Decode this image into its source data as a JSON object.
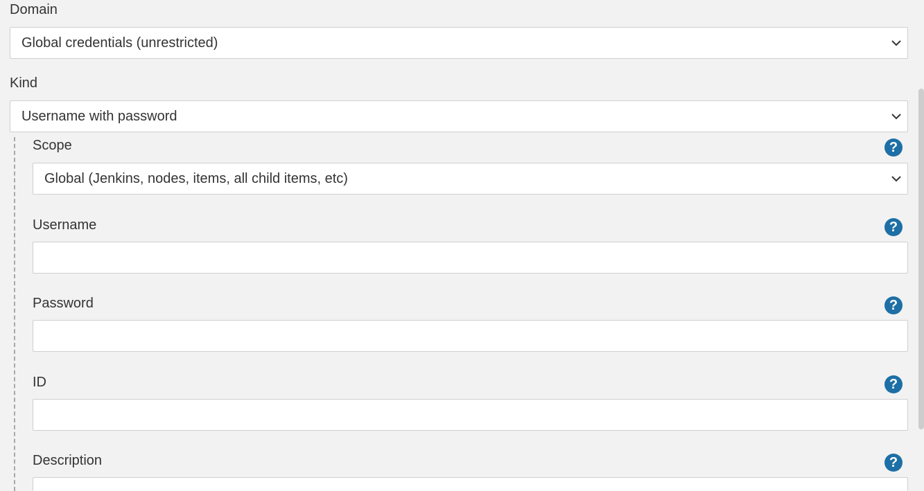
{
  "domain": {
    "label": "Domain",
    "value": "Global credentials (unrestricted)"
  },
  "kind": {
    "label": "Kind",
    "value": "Username with password"
  },
  "scope": {
    "label": "Scope",
    "value": "Global (Jenkins, nodes, items, all child items, etc)"
  },
  "username": {
    "label": "Username",
    "value": ""
  },
  "password": {
    "label": "Password",
    "value": ""
  },
  "id": {
    "label": "ID",
    "value": ""
  },
  "description": {
    "label": "Description",
    "value": ""
  },
  "help_glyph": "?",
  "icons": {
    "help": "question-circle-icon",
    "dropdown": "chevron-down-icon"
  },
  "colors": {
    "background": "#f2f2f2",
    "help_icon": "#1d6fa5",
    "field_border": "#cfcfcf"
  }
}
